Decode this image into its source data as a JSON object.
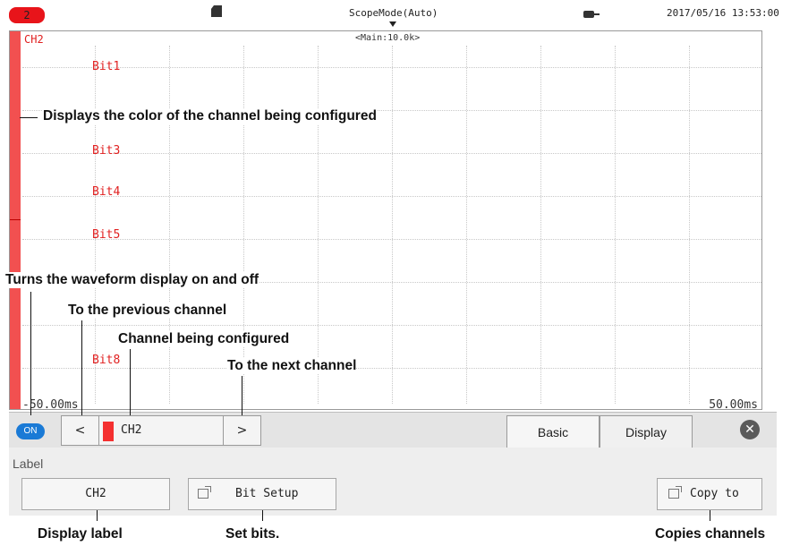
{
  "status_bar": {
    "alarm_label": "2",
    "mode": "ScopeMode(Auto)",
    "datetime": "2017/05/16 13:53:00",
    "icons": [
      "sd-card-icon",
      "trigger-marker-icon",
      "power-plug-icon"
    ]
  },
  "waveform": {
    "channel_title": "CH2",
    "main_rate": "<Main:10.0k>",
    "bits": [
      "Bit1",
      "Bit3",
      "Bit4",
      "Bit5",
      "Bit8"
    ],
    "time_left": "-50.00ms",
    "time_right": "50.00ms",
    "channel_color": "#f25050"
  },
  "controls": {
    "toggle_label": "ON",
    "prev_label": "<",
    "channel_label": "CH2",
    "next_label": ">",
    "tabs": [
      {
        "label": "Basic",
        "active": true
      },
      {
        "label": "Display",
        "active": false
      }
    ],
    "close_label": "✕"
  },
  "panel": {
    "label_caption": "Label",
    "label_value": "CH2",
    "bit_setup_label": "Bit Setup",
    "copy_to_label": "Copy to"
  },
  "annotations": {
    "color": "Displays the color of the channel being configured",
    "toggle": "Turns the waveform display on and off",
    "prev": "To the previous channel",
    "current": "Channel being configured",
    "next": "To the next channel",
    "display_label": "Display label",
    "set_bits": "Set bits.",
    "copies": "Copies channels"
  },
  "colors": {
    "accent_red": "#e02020",
    "toggle_blue": "#1a7ad6",
    "alarm_red": "#e8141a"
  }
}
